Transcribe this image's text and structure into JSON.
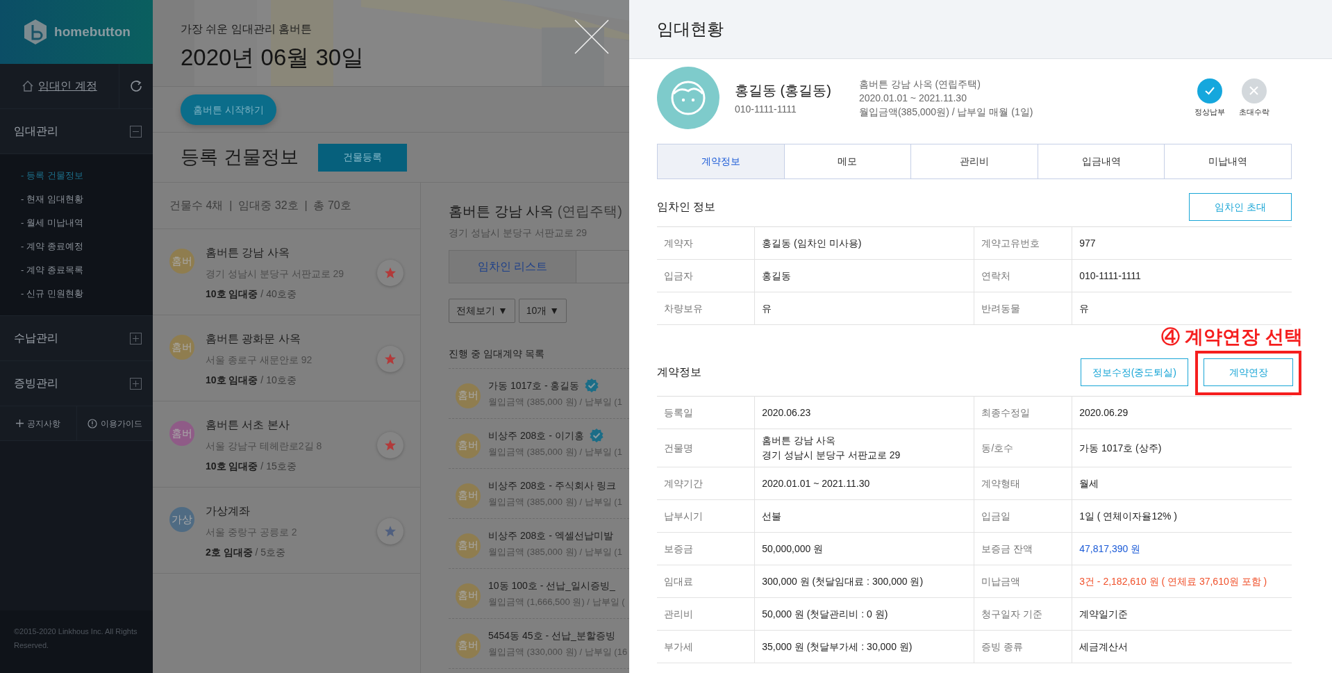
{
  "sidebar": {
    "logo": "homebutton",
    "account": "임대인 계정",
    "sections": [
      {
        "title": "임대관리",
        "expanded": true,
        "items": [
          {
            "label": "- 등록 건물정보",
            "selected": true
          },
          {
            "label": "- 현재 임대현황",
            "selected": false
          },
          {
            "label": "- 월세 미납내역",
            "selected": false
          },
          {
            "label": "- 계약 종료예정",
            "selected": false
          },
          {
            "label": "- 계약 종료목록",
            "selected": false
          },
          {
            "label": "- 신규 민원현황",
            "selected": false
          }
        ]
      },
      {
        "title": "수납관리",
        "expanded": false
      },
      {
        "title": "증빙관리",
        "expanded": false
      }
    ],
    "links": [
      {
        "kind": "plus",
        "label": "공지사항"
      },
      {
        "kind": "info",
        "label": "이용가이드"
      }
    ],
    "copyright": "©2015-2020 Linkhous Inc. All Rights Reserved."
  },
  "main": {
    "tagline": "가장 쉬운 임대관리 홈버튼",
    "date": "2020년 06월 30일",
    "start_button": "홈버튼 시작하기",
    "section_title": "등록 건물정보",
    "register_button": "건물등록",
    "stats": "건물수 4채  |  임대중 32호  |  총 70호",
    "buildings": [
      {
        "avatar": "홈버",
        "color": "#8f7d4f",
        "name": "홈버튼 강남 사옥",
        "address": "경기 성남시 분당구 서판교로 29",
        "rented": "10호 임대중",
        "total": " / 40호중",
        "star": {
          "color": "#b23a3a"
        }
      },
      {
        "avatar": "홈버",
        "color": "#8f7d4f",
        "name": "홈버튼 광화문 사옥",
        "address": "서울 종로구 새문안로 92",
        "rented": "10호 임대중",
        "total": " / 10호중",
        "star": {
          "color": "#b23a3a"
        }
      },
      {
        "avatar": "홈버",
        "color": "#8f5b87",
        "name": "홈버튼 서초 본사",
        "address": "서울 강남구 테헤란로2길 8",
        "rented": "10호 임대중",
        "total": " / 15호중",
        "star": {
          "color": "#b23a3a"
        }
      },
      {
        "avatar": "가상",
        "color": "#4f6b83",
        "name": "가상계좌",
        "address": "서울 중랑구 공릉로 2",
        "rented": "2호 임대중",
        "total": " / 5호중",
        "star": {
          "color": "#4f5f7f"
        }
      }
    ],
    "detail": {
      "title": "홈버튼 강남 사옥",
      "type": "(연립주택)",
      "address": "경기 성남시 분당구 서판교로 29",
      "tabs": [
        {
          "label": "임차인 리스트",
          "selected": true
        }
      ],
      "filters": [
        "전체보기 ▼",
        "10개 ▼"
      ],
      "contracts_title": "진행 중 임대계약 목록",
      "contracts": [
        {
          "avatar": "홈버",
          "title": "가동 1017호 - 홍길동",
          "verified": true,
          "detail": "월입금액 (385,000 원) / 납부일 (1"
        },
        {
          "avatar": "홈버",
          "title": "비상주 208호 - 이기홍",
          "verified": true,
          "detail": "월입금액 (385,000 원) / 납부일 (1"
        },
        {
          "avatar": "홈버",
          "title": "비상주 208호 - 주식회사 링크",
          "detail": "월입금액 (385,000 원) / 납부일 (1"
        },
        {
          "avatar": "홈버",
          "title": "비상주 208호 - 엑셀선납미발",
          "detail": "월입금액 (385,000 원) / 납부일 (1"
        },
        {
          "avatar": "홈버",
          "title": "10동 100호 - 선납_일시증빙_",
          "detail": "월입금액 (1,666,500 원) / 납부일 ("
        },
        {
          "avatar": "홈버",
          "title": "5454동 45호 - 선납_분할증빙",
          "detail": "월입금액 (330,000 원) / 납부일 (16"
        }
      ]
    }
  },
  "panel": {
    "title": "임대현황",
    "tenant": {
      "name": "홍길동 (홍길동)",
      "phone": "010-1111-1111",
      "building": "홈버튼 강남 사옥 (연립주택)",
      "period": "2020.01.01 ~ 2021.11.30",
      "payment": "월입금액(385,000원) / 납부일 매월 (1일)"
    },
    "badges": [
      {
        "kind": "check",
        "label": "정상납부",
        "on": true
      },
      {
        "kind": "cross",
        "label": "초대수락",
        "on": false
      }
    ],
    "tabs": [
      {
        "label": "계약정보",
        "selected": true
      },
      {
        "label": "메모",
        "selected": false
      },
      {
        "label": "관리비",
        "selected": false
      },
      {
        "label": "입금내역",
        "selected": false
      },
      {
        "label": "미납내역",
        "selected": false
      }
    ],
    "tenant_info": {
      "title": "임차인 정보",
      "buttons": [
        {
          "label": "임차인 초대",
          "highlighted": false
        }
      ],
      "rows": [
        [
          {
            "label": "계약자",
            "value": "홍길동 (임차인 미사용)"
          },
          {
            "label": "계약고유번호",
            "value": "977"
          }
        ],
        [
          {
            "label": "입금자",
            "value": "홍길동"
          },
          {
            "label": "연락처",
            "value": "010-1111-1111"
          }
        ],
        [
          {
            "label": "차량보유",
            "value": "유"
          },
          {
            "label": "반려동물",
            "value": "유"
          }
        ]
      ]
    },
    "annotation": "④ 계약연장 선택",
    "contract_info": {
      "title": "계약정보",
      "buttons": [
        {
          "label": "정보수정(중도퇴실)",
          "highlighted": false
        },
        {
          "label": "계약연장",
          "highlighted": true
        }
      ],
      "rows": [
        [
          {
            "label": "등록일",
            "value": "2020.06.23"
          },
          {
            "label": "최종수정일",
            "value": "2020.06.29"
          }
        ],
        [
          {
            "label": "건물명",
            "value": "홈버튼 강남 사옥",
            "note": "경기 성남시 분당구 서판교로 29"
          },
          {
            "label": "동/호수",
            "value": "가동 1017호 (상주)"
          }
        ],
        [
          {
            "label": "계약기간",
            "value": "2020.01.01 ~ 2021.11.30"
          },
          {
            "label": "계약형태",
            "value": "월세"
          }
        ],
        [
          {
            "label": "납부시기",
            "value": "선불"
          },
          {
            "label": "입금일",
            "value": "1일 ( 연체이자율12% )"
          }
        ],
        [
          {
            "label": "보증금",
            "value": "50,000,000 원"
          },
          {
            "label": "보증금 잔액",
            "value": "47,817,390 원",
            "color": "#1a5ad7"
          }
        ],
        [
          {
            "label": "임대료",
            "value": "300,000 원 (첫달임대료 : 300,000 원)"
          },
          {
            "label": "미납금액",
            "value": "3건 - 2,182,610 원 ( 연체료 37,610원 포함 )",
            "color": "#f0502a"
          }
        ],
        [
          {
            "label": "관리비",
            "value": "50,000 원 (첫달관리비 : 0 원)"
          },
          {
            "label": "청구일자 기준",
            "value": "계약일기준"
          }
        ],
        [
          {
            "label": "부가세",
            "value": "35,000 원 (첫달부가세 : 30,000 원)"
          },
          {
            "label": "증빙 종류",
            "value": "세금계산서"
          }
        ]
      ]
    }
  }
}
